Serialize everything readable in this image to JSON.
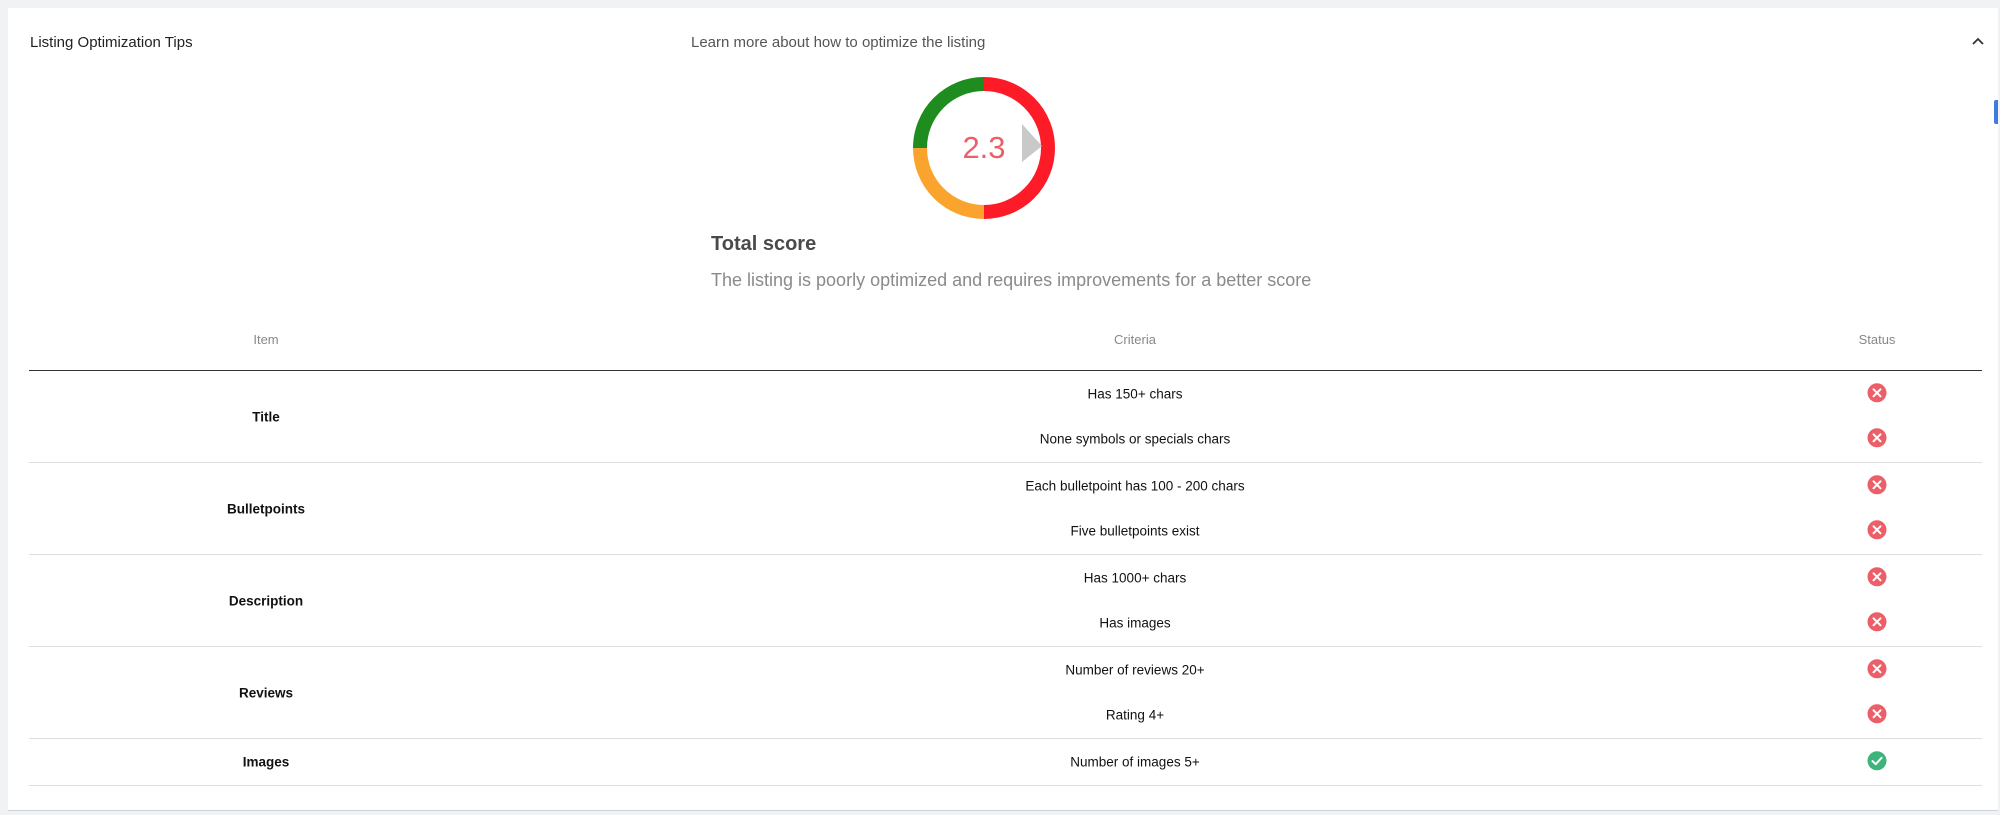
{
  "panel": {
    "title": "Listing Optimization Tips",
    "learn_more": "Learn more about how to optimize the listing",
    "collapse_icon": "chevron-up-icon"
  },
  "score": {
    "value": "2.3",
    "numeric": 2.3,
    "title": "Total score",
    "description": "The listing is poorly optimized and requires improvements for a better score",
    "colors": {
      "good": "#1e8c1e",
      "medium": "#fba42d",
      "poor": "#fc1b27",
      "value_text": "#ec5f68",
      "pointer": "#c9c9c9"
    }
  },
  "table": {
    "headers": {
      "item": "Item",
      "criteria": "Criteria",
      "status": "Status"
    },
    "groups": [
      {
        "item": "Title",
        "rows": [
          {
            "criteria": "Has 150+ chars",
            "status": "fail"
          },
          {
            "criteria": "None symbols or specials chars",
            "status": "fail"
          }
        ]
      },
      {
        "item": "Bulletpoints",
        "rows": [
          {
            "criteria": "Each bulletpoint has 100 - 200 chars",
            "status": "fail"
          },
          {
            "criteria": "Five bulletpoints exist",
            "status": "fail"
          }
        ]
      },
      {
        "item": "Description",
        "rows": [
          {
            "criteria": "Has 1000+ chars",
            "status": "fail"
          },
          {
            "criteria": "Has images",
            "status": "fail"
          }
        ]
      },
      {
        "item": "Reviews",
        "rows": [
          {
            "criteria": "Number of reviews 20+",
            "status": "fail"
          },
          {
            "criteria": "Rating 4+",
            "status": "fail"
          }
        ]
      },
      {
        "item": "Images",
        "rows": [
          {
            "criteria": "Number of images 5+",
            "status": "pass"
          }
        ]
      }
    ],
    "status_colors": {
      "fail": "#ec5f68",
      "pass": "#3db57a"
    }
  }
}
